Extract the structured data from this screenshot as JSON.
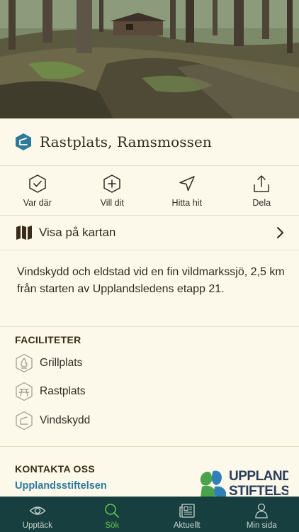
{
  "place": {
    "title": "Rastplats, Ramsmossen",
    "category_icon": "shelter-category-icon"
  },
  "actions": [
    {
      "label": "Var där",
      "icon": "check-hexagon-icon"
    },
    {
      "label": "Vill dit",
      "icon": "plus-hexagon-icon"
    },
    {
      "label": "Hitta hit",
      "icon": "navigate-arrow-icon"
    },
    {
      "label": "Dela",
      "icon": "share-icon"
    }
  ],
  "map_link": {
    "label": "Visa på kartan",
    "icon": "map-icon"
  },
  "description": "Vindskydd och eldstad vid en fin vildmarkssjö, 2,5 km från starten av Upplandsledens etapp 21.",
  "facilities": {
    "heading": "FACILITETER",
    "items": [
      {
        "label": "Grillplats",
        "icon": "fire-icon"
      },
      {
        "label": "Rastplats",
        "icon": "picnic-table-icon"
      },
      {
        "label": "Vindskydd",
        "icon": "shelter-icon"
      }
    ]
  },
  "contact": {
    "heading": "KONTAKTA OSS",
    "link": "Upplandsstiftelsen",
    "logo_line1": "UPPLANDS",
    "logo_line2": "STIFTELSEN"
  },
  "tabbar": [
    {
      "label": "Upptäck",
      "icon": "eye-icon",
      "active": false
    },
    {
      "label": "Sök",
      "icon": "search-icon",
      "active": true
    },
    {
      "label": "Aktuellt",
      "icon": "news-icon",
      "active": false
    },
    {
      "label": "Min sida",
      "icon": "user-icon",
      "active": false
    }
  ],
  "colors": {
    "accent": "#2d7a9a",
    "tabbar": "#173f3f",
    "active_tab": "#5ec74a",
    "background": "#fdf9ea"
  }
}
